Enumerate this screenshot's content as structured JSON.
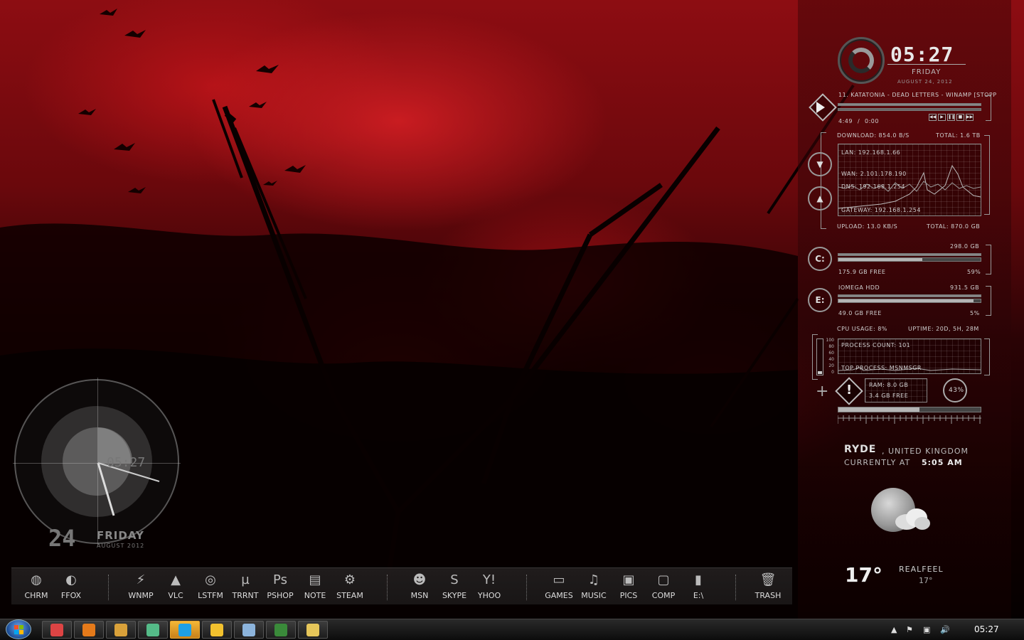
{
  "clock": {
    "time": "05:27",
    "day": "FRIDAY",
    "date": "AUGUST 24, 2012"
  },
  "winamp": {
    "track": "11. KATATONIA - DEAD LETTERS - WINAMP [STOPP",
    "elapsed": "4:49",
    "sep": "/",
    "total": "0:00"
  },
  "network": {
    "download": "DOWNLOAD: 854.0 B/S",
    "total_down": "TOTAL: 1.6 TB",
    "lan": "LAN: 192.168.1.66",
    "wan": "WAN: 2.101.178.190",
    "dns": "DNS: 192.168.1.254",
    "gateway": "GATEWAY: 192.168.1.254",
    "upload": "UPLOAD: 13.0 KB/S",
    "total_up": "TOTAL: 870.0 GB"
  },
  "drive_c": {
    "letter": "C:",
    "size": "298.0 GB",
    "free": "175.9 GB FREE",
    "percent": "59%",
    "fill": 0.59
  },
  "drive_e": {
    "letter": "E:",
    "name": "IOMEGA HDD",
    "size": "931.5 GB",
    "free": "49.0 GB FREE",
    "percent": "5%",
    "fill": 0.95
  },
  "system": {
    "cpu": "CPU USAGE: 8%",
    "uptime": "UPTIME: 20D, 5H, 28M",
    "process_count": "PROCESS COUNT: 101",
    "top_process": "TOP PROCESS: MSNMSGR",
    "ram": "RAM: 8.0 GB",
    "ram_free": "3.4 GB FREE",
    "ram_pct": "43%",
    "scale": [
      "100",
      "80",
      "60",
      "40",
      "20",
      "0"
    ]
  },
  "weather": {
    "city": "RYDE",
    "country": ", UNITED KINGDOM",
    "currently": "CURRENTLY AT",
    "time": "5:05 AM",
    "temp": "17°",
    "realfeel_label": "REALFEEL",
    "realfeel": "17°"
  },
  "left_clock": {
    "time": "05:27",
    "day_num": "24",
    "day": "FRIDAY",
    "month": "AUGUST 2012"
  },
  "dock": [
    {
      "label": "CHRM",
      "icon": "chrome-icon",
      "glyph": "◍"
    },
    {
      "label": "FFOX",
      "icon": "firefox-icon",
      "glyph": "◐"
    },
    {
      "label": "WNMP",
      "icon": "winamp-icon",
      "glyph": "⚡"
    },
    {
      "label": "VLC",
      "icon": "vlc-cone-icon",
      "glyph": "▲"
    },
    {
      "label": "LSTFM",
      "icon": "lastfm-icon",
      "glyph": "◎"
    },
    {
      "label": "TRRNT",
      "icon": "utorrent-icon",
      "glyph": "µ"
    },
    {
      "label": "PSHOP",
      "icon": "photoshop-icon",
      "glyph": "Ps"
    },
    {
      "label": "NOTE",
      "icon": "notepad-icon",
      "glyph": "▤"
    },
    {
      "label": "STEAM",
      "icon": "steam-icon",
      "glyph": "⚙"
    },
    {
      "label": "MSN",
      "icon": "msn-buddies-icon",
      "glyph": "☻"
    },
    {
      "label": "SKYPE",
      "icon": "skype-icon",
      "glyph": "S"
    },
    {
      "label": "YHOO",
      "icon": "yahoo-icon",
      "glyph": "Y!"
    },
    {
      "label": "GAMES",
      "icon": "games-controller-icon",
      "glyph": "▭"
    },
    {
      "label": "MUSIC",
      "icon": "music-folder-icon",
      "glyph": "♫"
    },
    {
      "label": "PICS",
      "icon": "pictures-folder-icon",
      "glyph": "▣"
    },
    {
      "label": "COMP",
      "icon": "computer-monitor-icon",
      "glyph": "▢"
    },
    {
      "label": "E:\\",
      "icon": "drive-e-icon",
      "glyph": "▮"
    },
    {
      "label": "TRASH",
      "icon": "trash-icon",
      "glyph": "🗑"
    }
  ],
  "taskbar": {
    "apps": [
      {
        "name": "chrome",
        "color": "#d44"
      },
      {
        "name": "firefox",
        "color": "#e57a1a"
      },
      {
        "name": "winamp",
        "color": "#d9a13a"
      },
      {
        "name": "network",
        "color": "#5b8"
      },
      {
        "name": "skype",
        "color": "#1ea0e6",
        "active": true
      },
      {
        "name": "yahoo-messenger",
        "color": "#f2c12e"
      },
      {
        "name": "notepad",
        "color": "#8cb4dc"
      },
      {
        "name": "utorrent",
        "color": "#3a8a3a"
      },
      {
        "name": "explorer",
        "color": "#e6c65a"
      }
    ],
    "time": "05:27"
  }
}
